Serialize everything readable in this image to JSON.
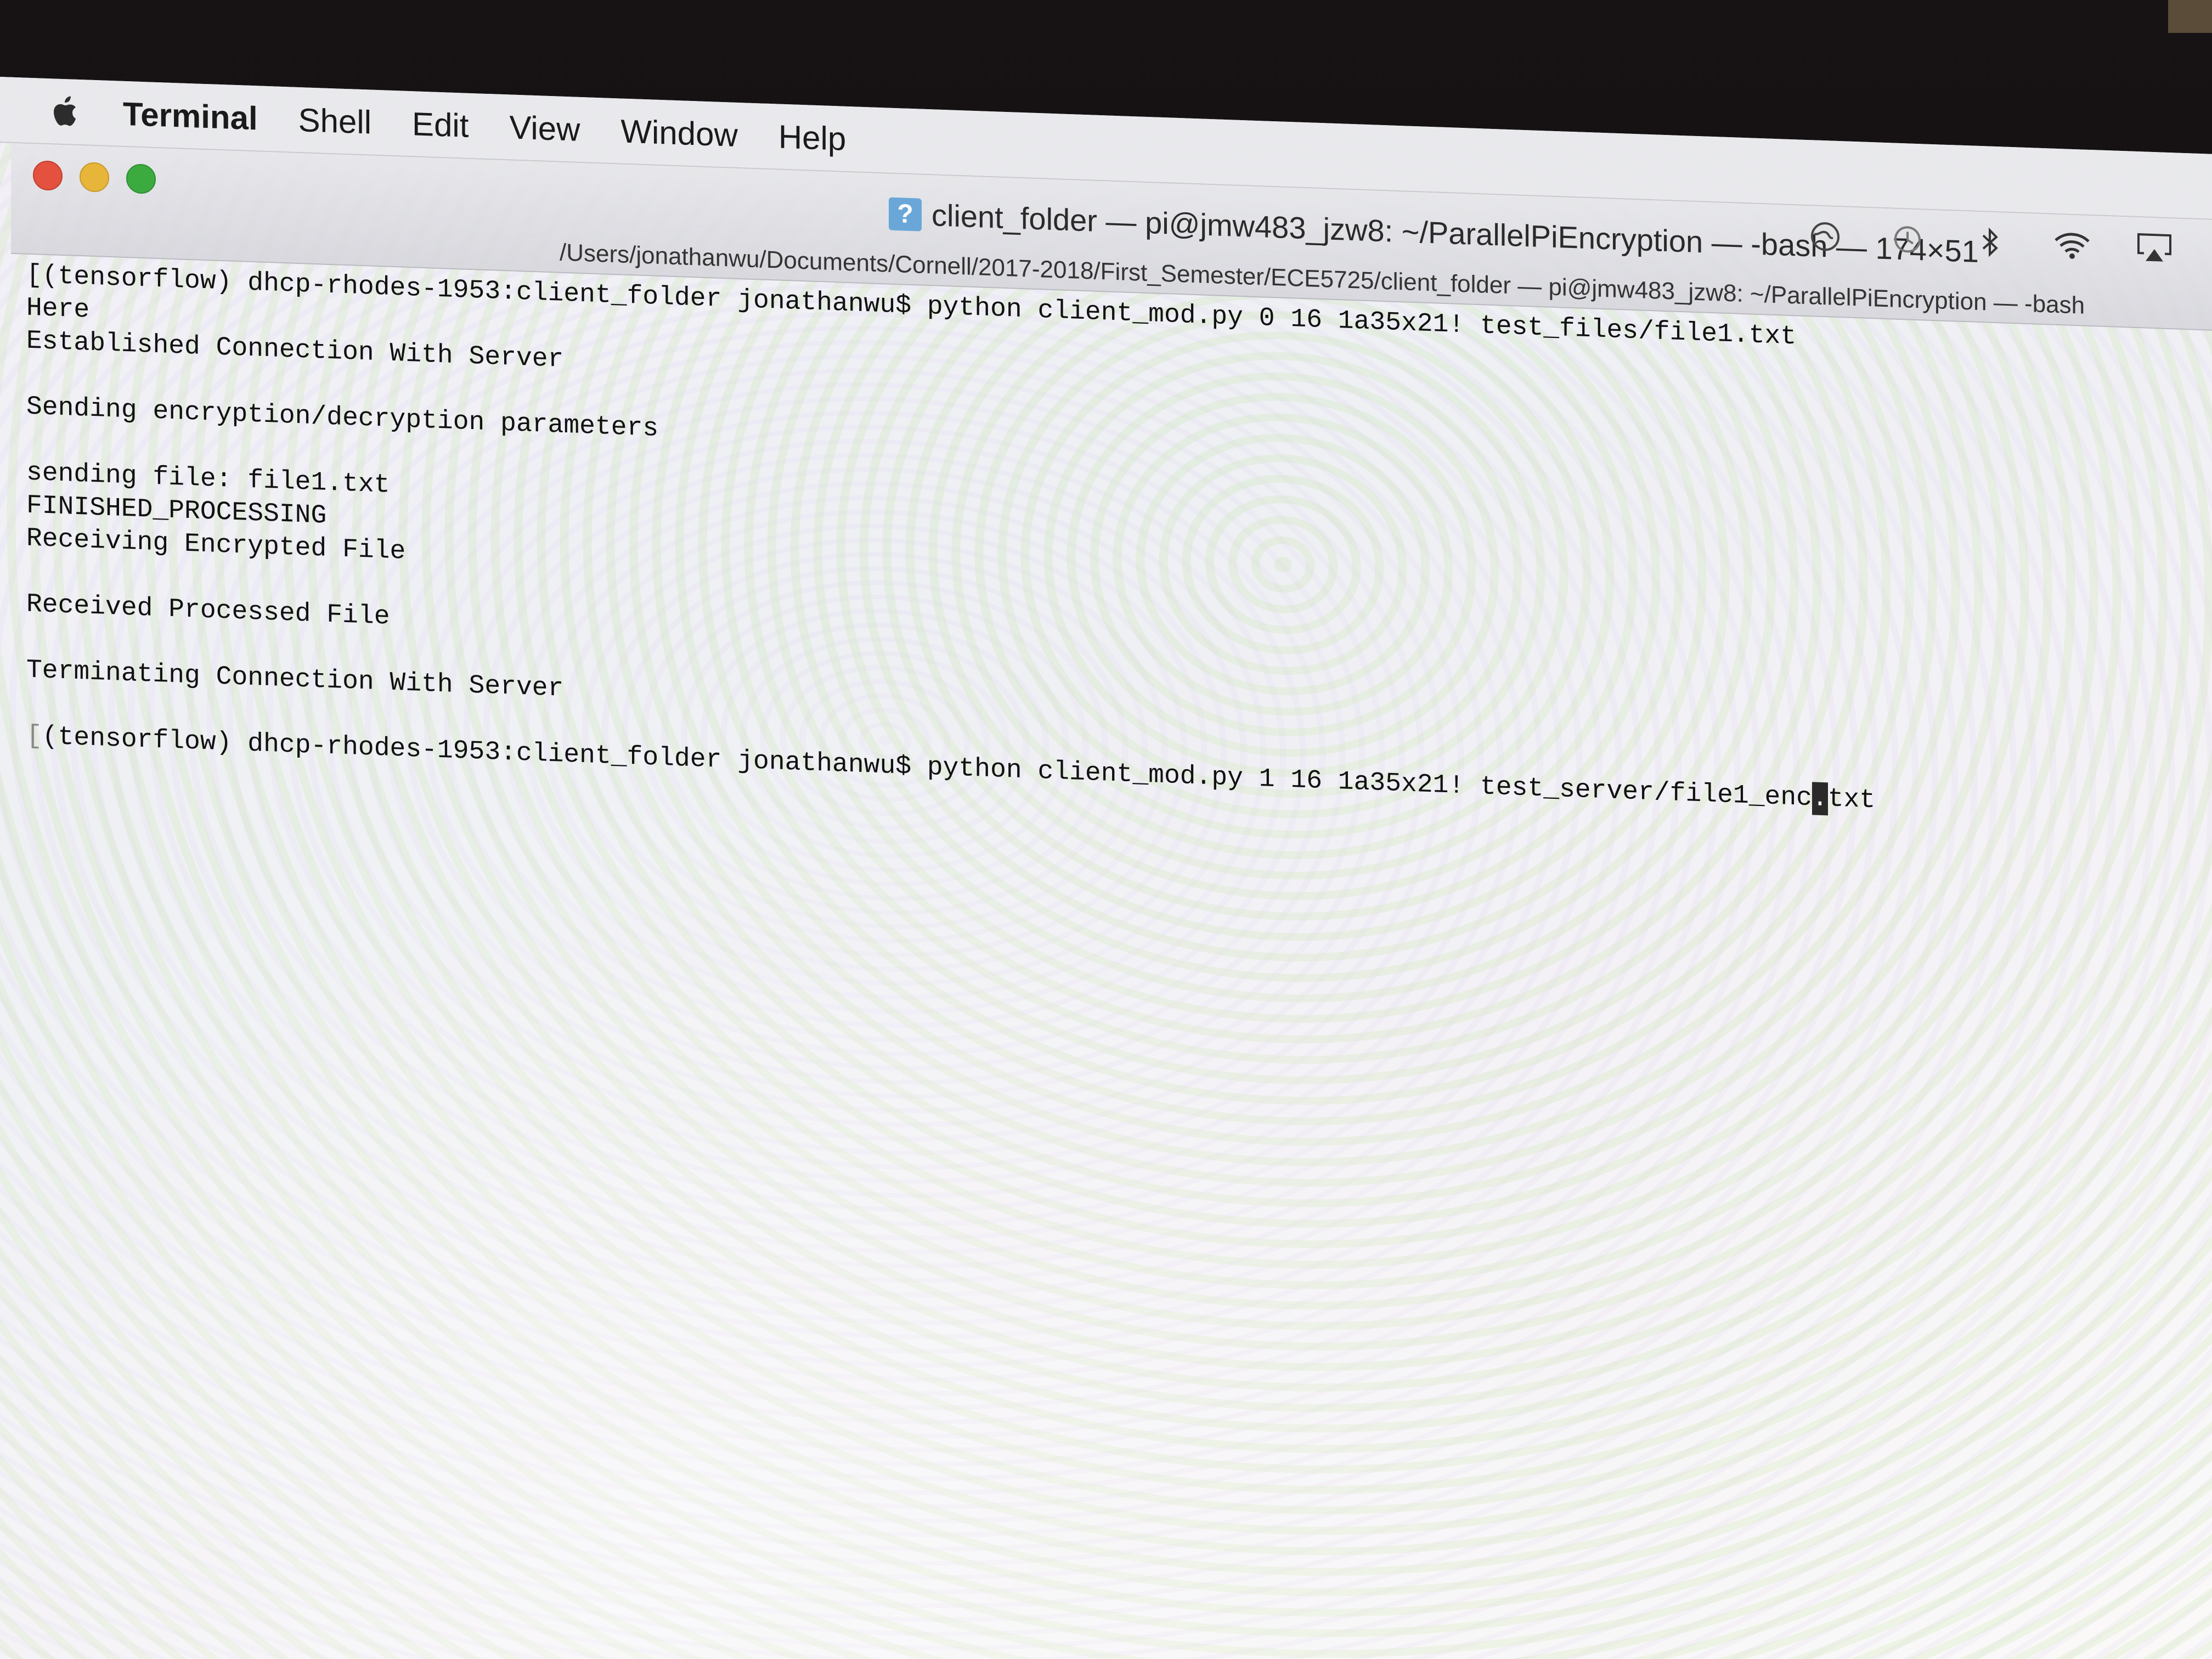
{
  "menubar": {
    "app_name": "Terminal",
    "items": [
      "Shell",
      "Edit",
      "View",
      "Window",
      "Help"
    ]
  },
  "window": {
    "title": "client_folder — pi@jmw483_jzw8: ~/ParallelPiEncryption — -bash — 174×51",
    "tab_path": "/Users/jonathanwu/Documents/Cornell/2017-2018/First_Semester/ECE5725/client_folder — pi@jmw483_jzw8: ~/ParallelPiEncryption — -bash"
  },
  "status_icons": [
    "globe-icon",
    "time-machine-icon",
    "bluetooth-icon",
    "wifi-icon",
    "airplay-icon"
  ],
  "terminal": {
    "prompt_marker": "[",
    "lines": [
      "(tensorflow) dhcp-rhodes-1953:client_folder jonathanwu$ python client_mod.py 0 16 1a35x21! test_files/file1.txt",
      "Here",
      "Established Connection With Server",
      "",
      "Sending encryption/decryption parameters",
      "",
      "sending file: file1.txt",
      "FINISHED_PROCESSING",
      "Receiving Encrypted File",
      "",
      "Received Processed File",
      "",
      "Terminating Connection With Server",
      ""
    ],
    "current_command_prefix": "(tensorflow) dhcp-rhodes-1953:client_folder jonathanwu$ python client_mod.py 1 16 1a35x21! test_server/file1_enc",
    "cursor_char": ".",
    "current_command_suffix": "txt"
  },
  "colors": {
    "close": "#e4513f",
    "minimize": "#e6b53a",
    "zoom": "#3cab3f"
  }
}
